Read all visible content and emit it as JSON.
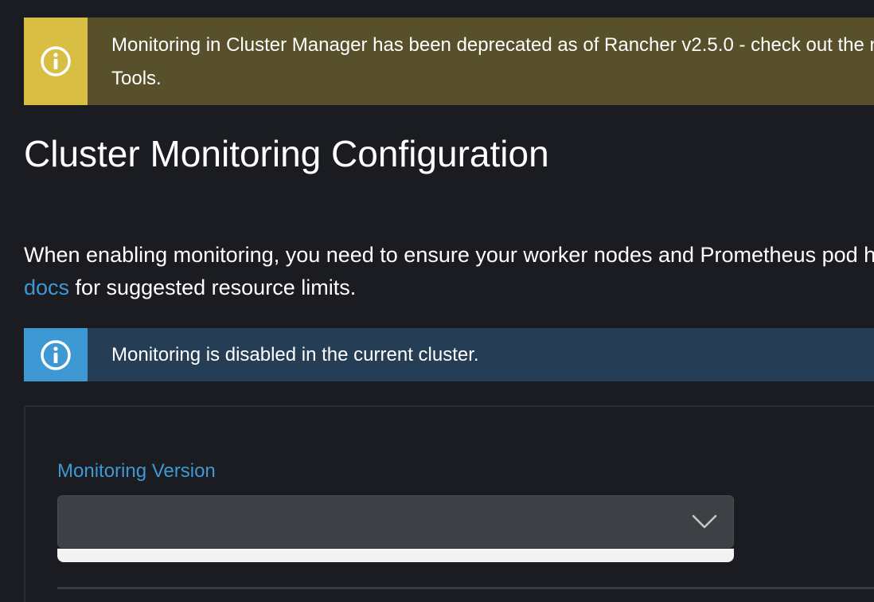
{
  "deprecation_banner": {
    "icon": "info-circle-icon",
    "line1": "Monitoring in Cluster Manager has been deprecated as of Rancher v2.5.0 - check out the new Monitoring feature in Cluster Explorer > Cluster",
    "line2": "Tools."
  },
  "page_title": "Cluster Monitoring Configuration",
  "intro": {
    "line1": "When enabling monitoring, you need to ensure your worker nodes and Prometheus pod have enough resources. Please visit the Rancher",
    "docs_link": "docs",
    "line2_rest": " for suggested resource limits."
  },
  "status_banner": {
    "icon": "info-circle-icon",
    "text": "Monitoring is disabled in the current cluster."
  },
  "monitoring_version": {
    "label": "Monitoring Version",
    "selected_value": "",
    "dropdown_icon": "chevron-down-icon"
  },
  "colors": {
    "background": "#1b1c21",
    "warning_icon_bg": "#d8be43",
    "warning_bg": "#57502b",
    "info_icon_bg": "#3d98d3",
    "info_bg": "#253e56",
    "link": "#3d98d3",
    "select_bg": "#3f4045"
  }
}
